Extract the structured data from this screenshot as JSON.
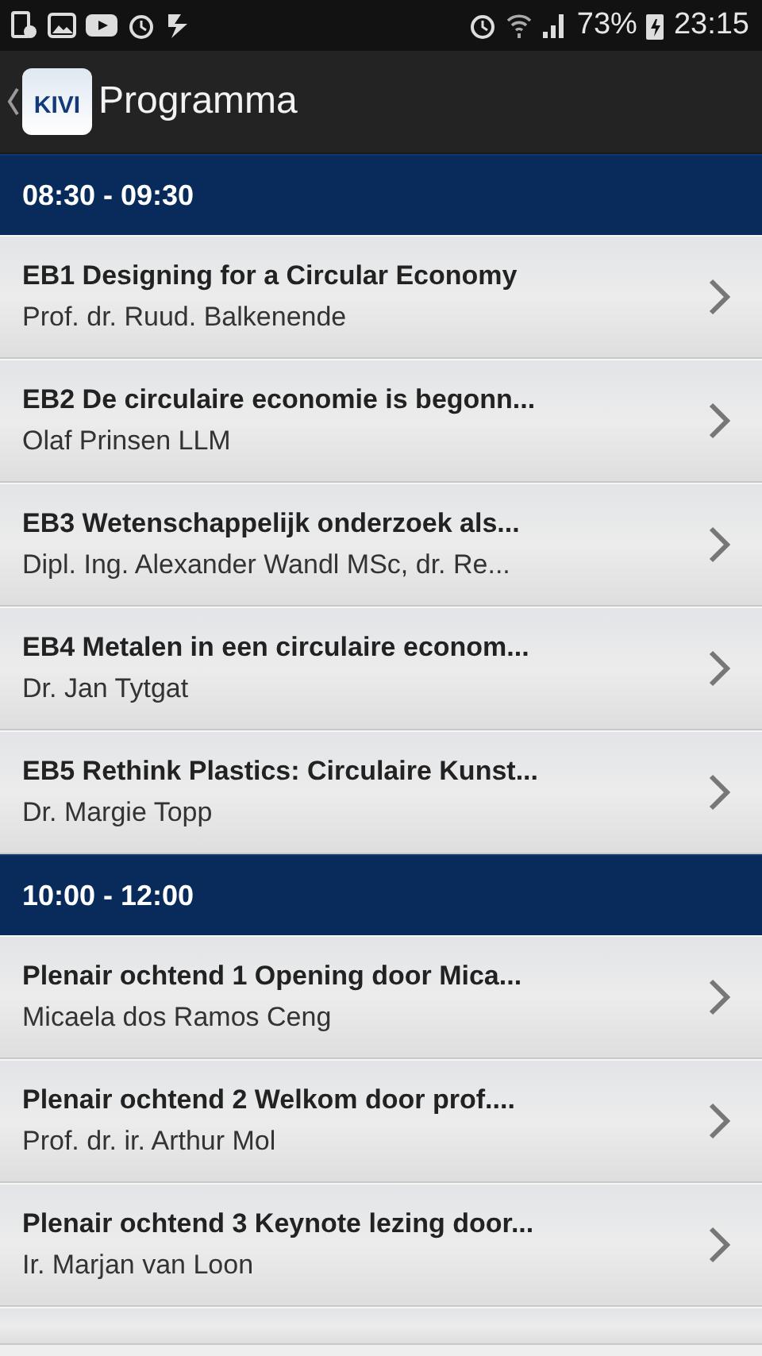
{
  "status_bar": {
    "battery": "73%",
    "time": "23:15"
  },
  "header": {
    "logo": "KIVI",
    "title": "Programma"
  },
  "sections": [
    {
      "time": "08:30 - 09:30",
      "items": [
        {
          "title": "EB1 Designing for a Circular Economy",
          "speaker": "Prof. dr. Ruud. Balkenende"
        },
        {
          "title": "EB2 De circulaire economie is begonn...",
          "speaker": "Olaf Prinsen LLM"
        },
        {
          "title": "EB3 Wetenschappelijk onderzoek als...",
          "speaker": "Dipl. Ing. Alexander Wandl MSc, dr. Re..."
        },
        {
          "title": "EB4 Metalen in een circulaire econom...",
          "speaker": "Dr. Jan Tytgat"
        },
        {
          "title": "EB5 Rethink Plastics: Circulaire Kunst...",
          "speaker": "Dr. Margie Topp"
        }
      ]
    },
    {
      "time": "10:00 - 12:00",
      "items": [
        {
          "title": "Plenair ochtend 1 Opening door Mica...",
          "speaker": "Micaela dos Ramos Ceng"
        },
        {
          "title": "Plenair ochtend 2 Welkom door prof....",
          "speaker": "Prof. dr. ir. Arthur Mol"
        },
        {
          "title": "Plenair ochtend 3 Keynote lezing door...",
          "speaker": "Ir. Marjan van Loon"
        }
      ]
    }
  ]
}
